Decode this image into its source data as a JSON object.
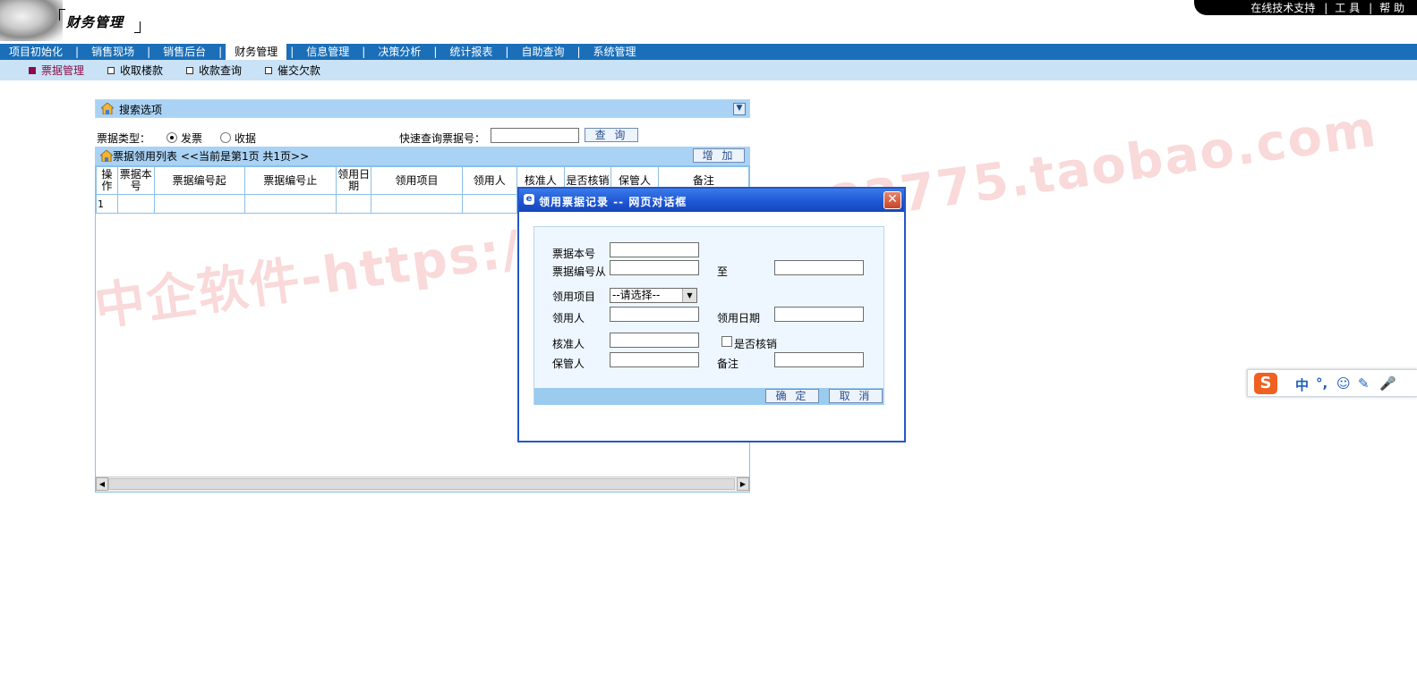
{
  "header": {
    "app_title": "财务管理",
    "top_links": [
      "在线技术支持",
      "工 具",
      "帮 助"
    ]
  },
  "main_nav": {
    "items": [
      "项目初始化",
      "销售现场",
      "销售后台",
      "财务管理",
      "信息管理",
      "决策分析",
      "统计报表",
      "自助查询",
      "系统管理"
    ],
    "active": "财务管理"
  },
  "sub_nav": {
    "items": [
      "票据管理",
      "收取楼款",
      "收款查询",
      "催交欠款"
    ],
    "active": "票据管理"
  },
  "search_panel": {
    "title": "搜索选项",
    "collapse_glyph": "▼",
    "type_label": "票据类型：",
    "type_options": [
      "发票",
      "收据"
    ],
    "selected_type": "发票",
    "quick_label": "快速查询票据号：",
    "quick_value": "",
    "query_button": "查 询"
  },
  "list": {
    "title": "票据领用列表",
    "page_info": "<<当前是第1页  共1页>>",
    "add_button": "增 加",
    "columns": [
      "操作",
      "票据本号",
      "票据编号起",
      "票据编号止",
      "领用日期",
      "领用项目",
      "领用人",
      "核准人",
      "是否核销",
      "保管人",
      "备注"
    ],
    "rows": [
      [
        "1",
        "",
        "",
        "",
        "",
        "",
        "",
        "",
        "",
        "",
        ""
      ]
    ]
  },
  "watermark": "中企软件-https://shop119983775.taobao.com",
  "dialog": {
    "title": "领用票据记录 -- 网页对话框",
    "fields": {
      "book_no": {
        "label": "票据本号",
        "value": ""
      },
      "serial_from": {
        "label": "票据编号从",
        "value": ""
      },
      "serial_to": {
        "label": "至",
        "value": ""
      },
      "project": {
        "label": "领用项目",
        "selected": "--请选择--"
      },
      "recipient": {
        "label": "领用人",
        "value": ""
      },
      "issue_date": {
        "label": "领用日期",
        "value": ""
      },
      "approver": {
        "label": "核准人",
        "value": ""
      },
      "written_off": {
        "label": "是否核销",
        "checked": false
      },
      "custodian": {
        "label": "保管人",
        "value": ""
      },
      "remark": {
        "label": "备注",
        "value": ""
      }
    },
    "ok_button": "确 定",
    "cancel_button": "取 消",
    "close_glyph": "✕"
  },
  "ime_toolbar": {
    "logo": "S",
    "items": [
      "中",
      "°,",
      "☺",
      "✎",
      "🎤"
    ]
  }
}
